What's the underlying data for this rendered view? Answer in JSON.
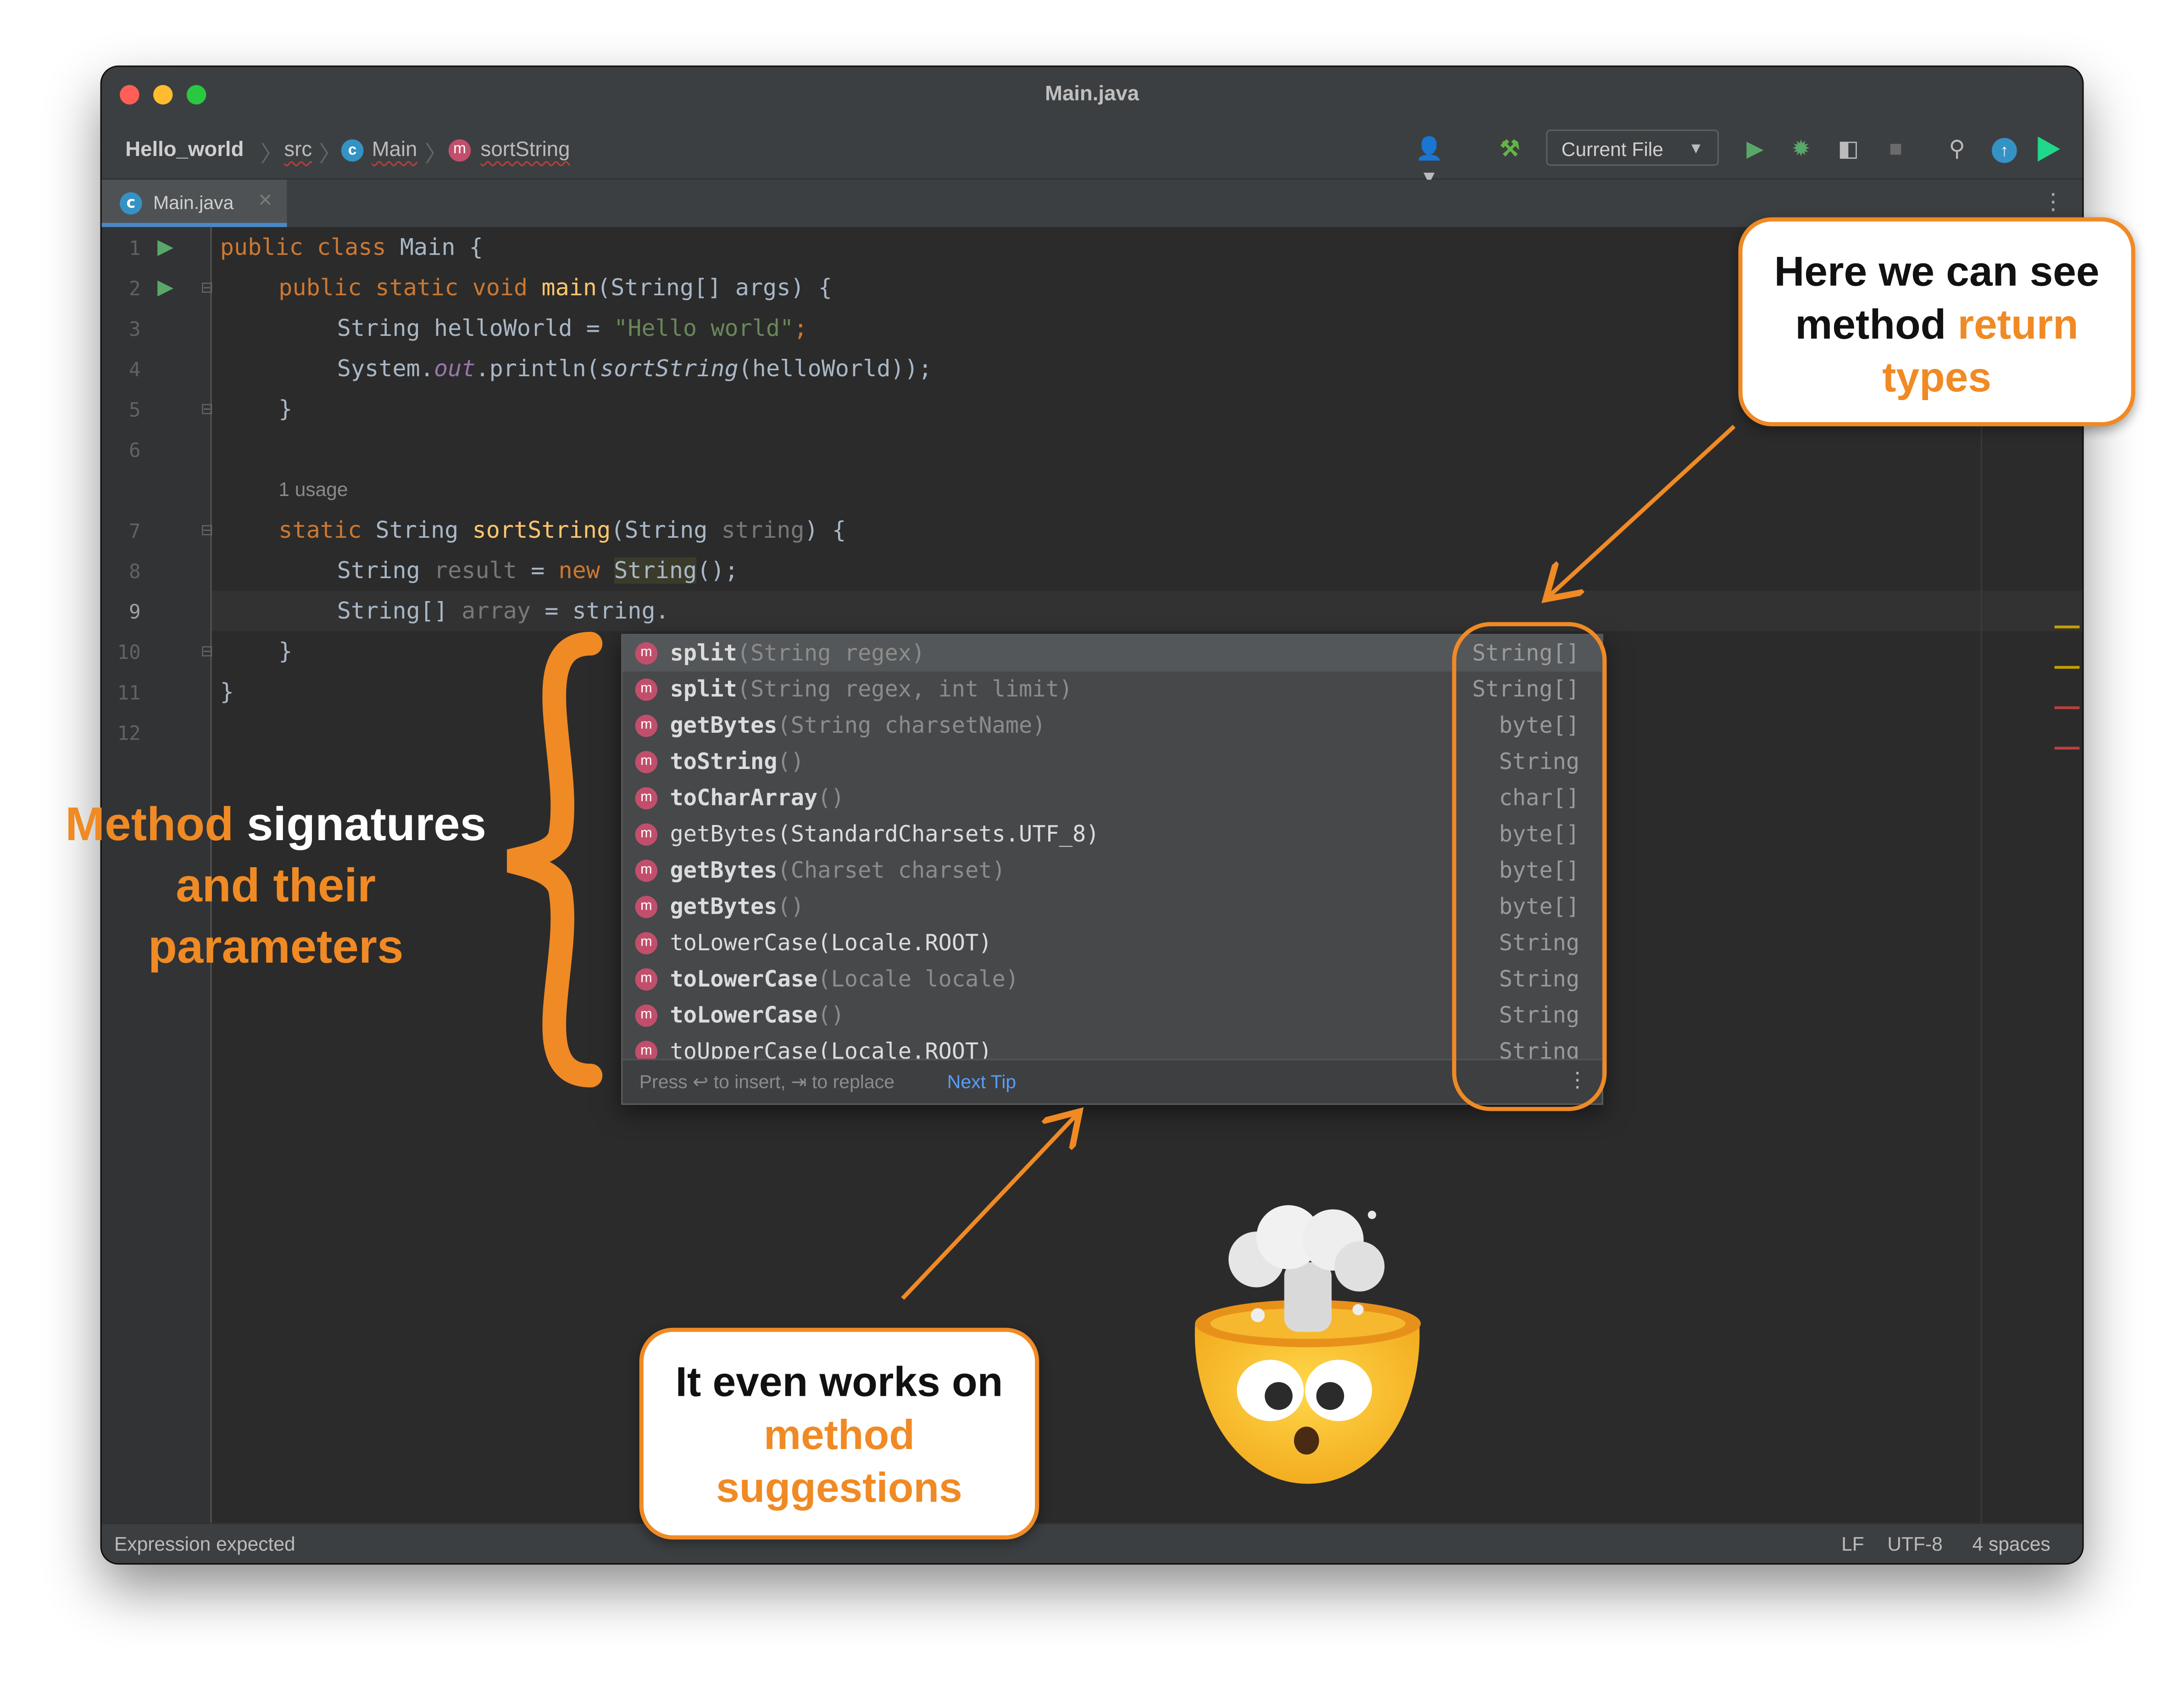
{
  "window": {
    "title": "Main.java"
  },
  "breadcrumb": {
    "project": "Hello_world",
    "folder": "src",
    "class": "Main",
    "method": "sortString"
  },
  "toolbar": {
    "run_config": "Current File"
  },
  "tabs": [
    {
      "label": "Main.java"
    }
  ],
  "editor": {
    "line_numbers": [
      "1",
      "2",
      "3",
      "4",
      "5",
      "6",
      "7",
      "8",
      "9",
      "10",
      "11",
      "12"
    ],
    "usage_hint": "1 usage",
    "lines": {
      "l1": [
        "public class ",
        "Main {"
      ],
      "l2": [
        "public static void ",
        "main",
        "(String[] args) {"
      ],
      "l3": [
        "String helloWorld = ",
        "\"Hello world\"",
        ";"
      ],
      "l4": [
        "System.",
        "out",
        ".println(",
        "sortString",
        "(helloWorld));"
      ],
      "l5": "}",
      "l7": [
        "static ",
        "String ",
        "sortString",
        "(String ",
        "string",
        ") {"
      ],
      "l8": [
        "String ",
        "result",
        " = ",
        "new ",
        "String",
        "();"
      ],
      "l9": [
        "String[] ",
        "array",
        " = ",
        "string."
      ],
      "l10": "}",
      "l11": "}"
    }
  },
  "completion": {
    "items": [
      {
        "icon": "m",
        "name": "split",
        "params": "(String regex)",
        "type": "String[]"
      },
      {
        "icon": "m",
        "name": "split",
        "params": "(String regex, int limit)",
        "type": "String[]"
      },
      {
        "icon": "m",
        "name": "getBytes",
        "params": "(String charsetName)",
        "type": "byte[]"
      },
      {
        "icon": "m",
        "name": "toString",
        "params": "()",
        "type": "String"
      },
      {
        "icon": "m",
        "name": "toCharArray",
        "params": "()",
        "type": "char[]"
      },
      {
        "icon": "m",
        "name": "getBytes(StandardCharsets.UTF_8)",
        "params": "",
        "type": "byte[]"
      },
      {
        "icon": "m",
        "name": "getBytes",
        "params": "(Charset charset)",
        "type": "byte[]"
      },
      {
        "icon": "m",
        "name": "getBytes",
        "params": "()",
        "type": "byte[]"
      },
      {
        "icon": "m",
        "name": "toLowerCase(Locale.ROOT)",
        "params": "",
        "type": "String"
      },
      {
        "icon": "m",
        "name": "toLowerCase",
        "params": "(Locale locale)",
        "type": "String"
      },
      {
        "icon": "m",
        "name": "toLowerCase",
        "params": "()",
        "type": "String"
      },
      {
        "icon": "m",
        "name": "toUpperCase(Locale.ROOT)",
        "params": "",
        "type": "String"
      }
    ],
    "footer": {
      "hint": "Press ↩ to insert, ⇥ to replace",
      "link": "Next Tip"
    }
  },
  "status": {
    "message": "Expression expected",
    "line_sep": "LF",
    "encoding": "UTF-8",
    "indent": "4 spaces"
  },
  "annotations": {
    "return_types": [
      "Here we can see",
      "method ",
      "return",
      "types"
    ],
    "signatures": [
      "M",
      "ethod",
      " signatures",
      "and their",
      "parameters"
    ],
    "suggestions": [
      "It even works on",
      "method",
      "suggestions"
    ]
  },
  "colors": {
    "accent": "#f08a24",
    "editor_bg": "#2b2b2b",
    "keyword": "#cc7832",
    "function": "#ffc66d",
    "string": "#6a8759"
  }
}
